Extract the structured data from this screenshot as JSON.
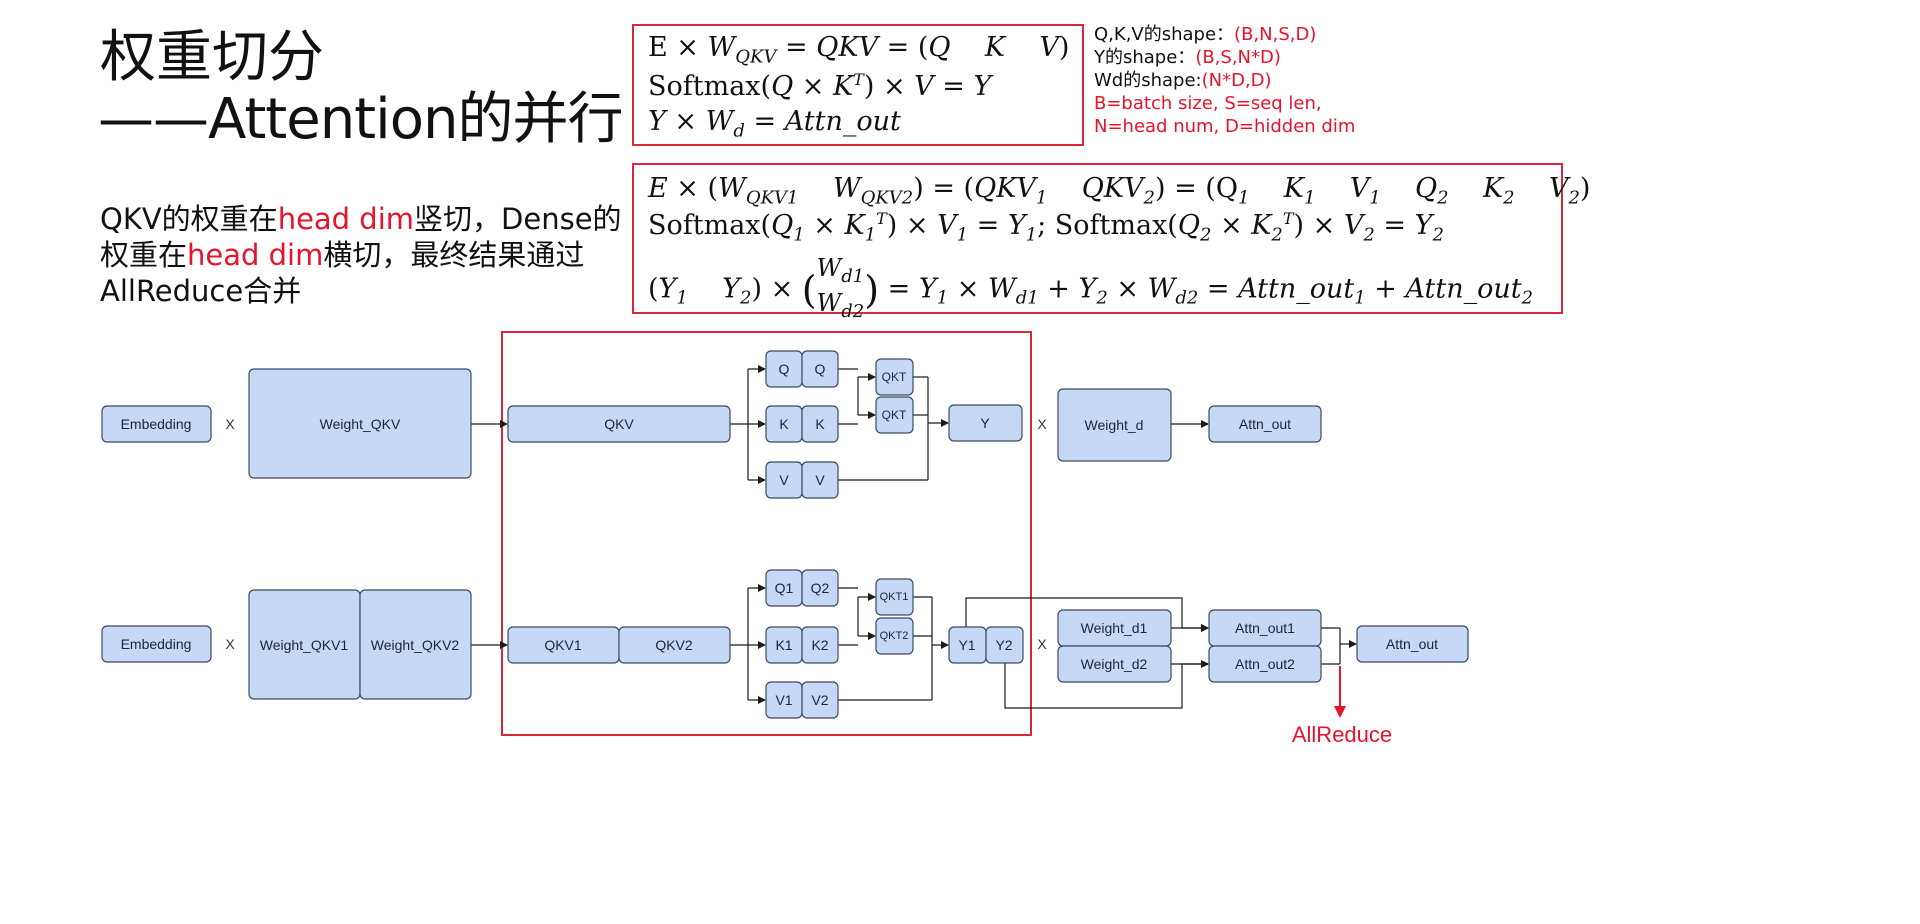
{
  "title": {
    "line1": "权重切分",
    "line2": "——Attention的并行"
  },
  "description": {
    "p1": "QKV的权重在",
    "p1_hl": "head dim",
    "p2": "竖切，Dense的权重在",
    "p2_hl": "head dim",
    "p3": "横切，最终结果通过AllReduce合并"
  },
  "legend": {
    "qkv_label": "Q,K,V的shape：",
    "qkv_value": "(B,N,S,D)",
    "y_label": "Y的shape：",
    "y_value": "(B,S,N*D)",
    "wd_label": "Wd的shape:",
    "wd_value": "(N*D,D)",
    "note1": "B=batch size, S=seq len,",
    "note2": "N=head num, D=hidden dim"
  },
  "diagram": {
    "top": {
      "embedding": "Embedding",
      "weight_qkv": "Weight_QKV",
      "qkv": "QKV",
      "q_a": "Q",
      "q_b": "Q",
      "k_a": "K",
      "k_b": "K",
      "v_a": "V",
      "v_b": "V",
      "qkt_a": "QKT",
      "qkt_b": "QKT",
      "y": "Y",
      "weight_d": "Weight_d",
      "attn_out": "Attn_out"
    },
    "bottom": {
      "embedding": "Embedding",
      "weight_qkv1": "Weight_QKV1",
      "weight_qkv2": "Weight_QKV2",
      "qkv1": "QKV1",
      "qkv2": "QKV2",
      "q1": "Q1",
      "q2": "Q2",
      "k1": "K1",
      "k2": "K2",
      "v1": "V1",
      "v2": "V2",
      "qkt1": "QKT1",
      "qkt2": "QKT2",
      "y1": "Y1",
      "y2": "Y2",
      "weight_d1": "Weight_d1",
      "weight_d2": "Weight_d2",
      "attn_out1": "Attn_out1",
      "attn_out2": "Attn_out2",
      "attn_out": "Attn_out"
    },
    "operator_x": "X",
    "allreduce": "AllReduce"
  },
  "colors": {
    "node_fill": "#c5d9f7",
    "highlight_red": "#e8132b",
    "box_border": "#d9283a"
  }
}
